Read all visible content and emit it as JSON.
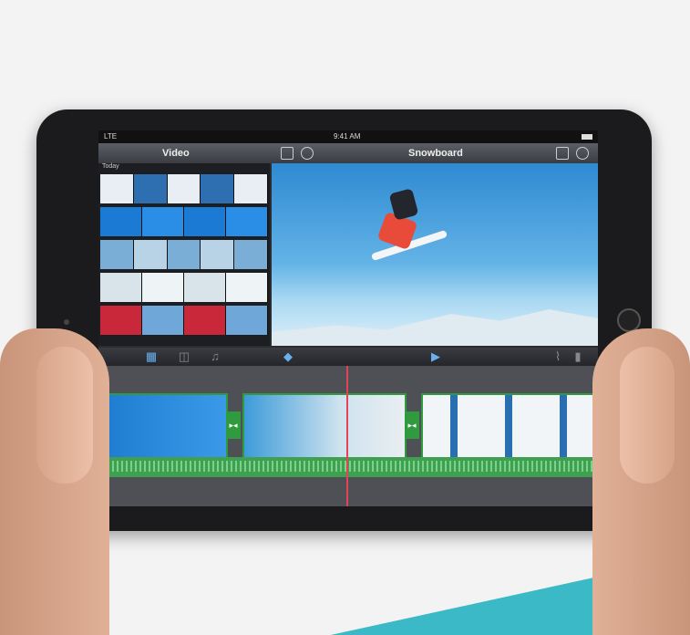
{
  "status_bar": {
    "carrier": "LTE",
    "time": "9:41 AM"
  },
  "nav": {
    "left_title": "Video",
    "right_title": "Snowboard"
  },
  "browser": {
    "section_label": "Today"
  },
  "toolbar": {
    "icons": [
      "video-icon",
      "photo-icon",
      "music-icon",
      "split-icon",
      "play-icon",
      "microphone-icon",
      "camera-icon"
    ]
  },
  "colors": {
    "accent_blue": "#3a8fe3",
    "timeline_green": "#2f9a3e",
    "playhead": "#e24456",
    "teal_shape": "#3cb9c6"
  }
}
